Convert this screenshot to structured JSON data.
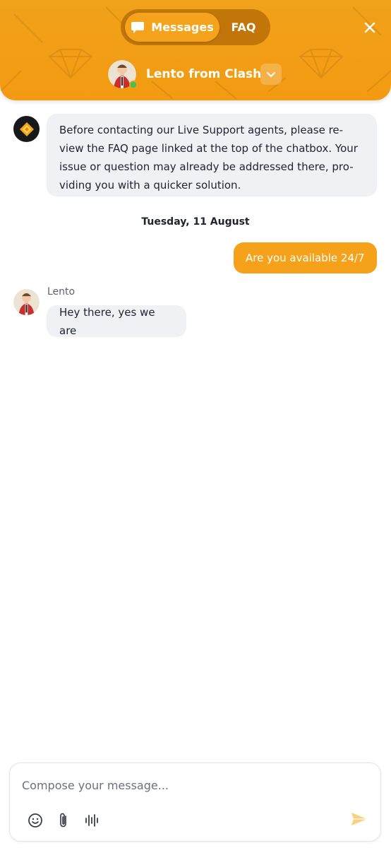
{
  "header": {
    "tabs": [
      {
        "label": "Messages",
        "active": true,
        "icon": "chat-bubble-icon"
      },
      {
        "label": "FAQ",
        "active": false
      }
    ],
    "agent_name": "Lento from Clash",
    "agent_status": "online",
    "close_icon": "close-icon",
    "toggle_icon": "chevron-down-icon"
  },
  "messages": {
    "intro_text": "Before contacting our Live Support agents, please re-view the FAQ page linked at the top of the chatbox. Your issue or question may already be addressed there, pro-viding you with a quicker solution.",
    "date_separator": "Tuesday, 11 August",
    "outgoing": "Are you available 24/7",
    "incoming_sender": "Lento",
    "incoming": "Hey there, yes we are"
  },
  "composer": {
    "placeholder": "Compose your message...",
    "value": "",
    "tools": [
      "emoji-icon",
      "paperclip-icon",
      "voice-icon"
    ],
    "send_icon": "send-icon"
  },
  "colors": {
    "brand": "#f39a12",
    "bubble_out": "#f5a11a",
    "bubble_in": "#f0f1f5",
    "online": "#34c759"
  }
}
